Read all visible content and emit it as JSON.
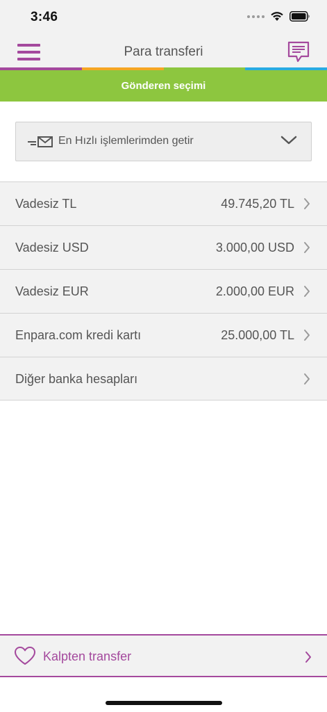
{
  "status_bar": {
    "time": "3:46"
  },
  "nav": {
    "title": "Para transferi"
  },
  "colors": {
    "brand_purple": "#a4499d",
    "header_green": "#8dc63f",
    "strip": [
      "#a4499d",
      "#f5a623",
      "#8dc63f",
      "#29abe2"
    ]
  },
  "section_header": {
    "title": "Gönderen seçimi"
  },
  "dropdown": {
    "label": "En Hızlı işlemlerimden getir",
    "icon": "quick-transfer-mail-icon"
  },
  "accounts": [
    {
      "name": "Vadesiz TL",
      "balance": "49.745,20 TL"
    },
    {
      "name": "Vadesiz USD",
      "balance": "3.000,00 USD"
    },
    {
      "name": "Vadesiz EUR",
      "balance": "2.000,00 EUR"
    },
    {
      "name": "Enpara.com kredi kartı",
      "balance": "25.000,00 TL"
    },
    {
      "name": "Diğer banka hesapları",
      "balance": ""
    }
  ],
  "footer": {
    "label": "Kalpten transfer",
    "icon": "heart-icon"
  }
}
